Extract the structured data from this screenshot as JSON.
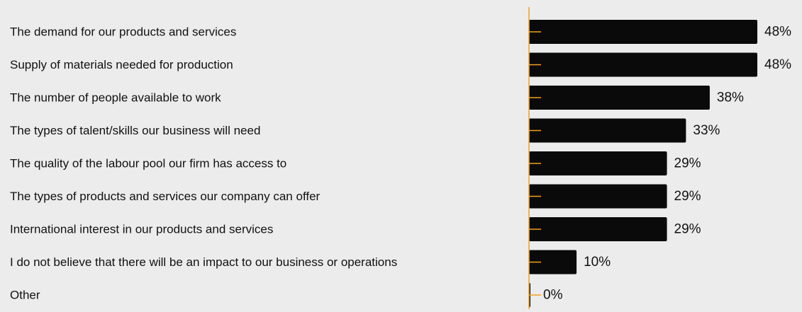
{
  "chart_data": {
    "type": "bar",
    "orientation": "horizontal",
    "categories": [
      "The demand for our products and services",
      "Supply of materials needed for production",
      "The number of people available to work",
      "The types of talent/skills our business will need",
      "The quality of the labour pool our firm has access to",
      "The types of products and services our company can offer",
      "International interest in our products and services",
      "I do not believe that there will be an impact to our business or operations",
      "Other"
    ],
    "values": [
      48,
      48,
      38,
      33,
      29,
      29,
      29,
      10,
      0
    ],
    "value_labels": [
      "48%",
      "48%",
      "38%",
      "33%",
      "29%",
      "29%",
      "29%",
      "10%",
      "0%"
    ],
    "xlim": [
      0,
      48
    ],
    "grid": false,
    "legend": "none",
    "colors": {
      "bar": "#0a0a0a",
      "axis": "#f0a020",
      "background": "#ececec",
      "text": "#111111"
    }
  }
}
